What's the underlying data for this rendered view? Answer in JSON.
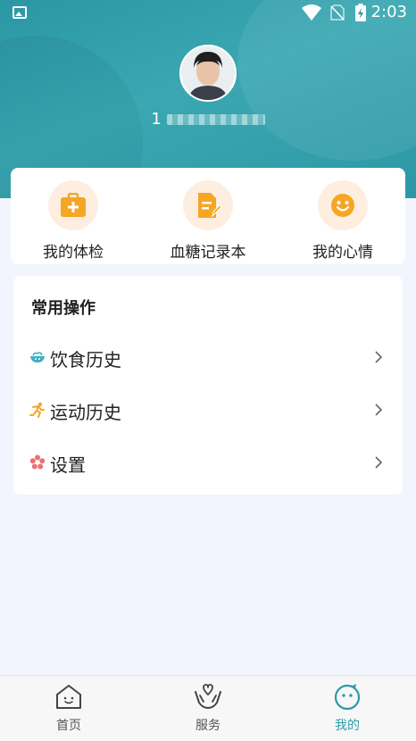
{
  "status_bar": {
    "time": "2:03"
  },
  "profile": {
    "phone_prefix": "1"
  },
  "quick_actions": [
    {
      "label": "我的体检",
      "icon": "medical-kit-icon"
    },
    {
      "label": "血糖记录本",
      "icon": "notebook-edit-icon"
    },
    {
      "label": "我的心情",
      "icon": "smile-face-icon"
    }
  ],
  "common_ops": {
    "title": "常用操作",
    "items": [
      {
        "label": "饮食历史",
        "icon": "food-bowl-icon"
      },
      {
        "label": "运动历史",
        "icon": "running-icon"
      },
      {
        "label": "设置",
        "icon": "flower-gear-icon"
      }
    ]
  },
  "tabs": [
    {
      "label": "首页",
      "icon": "home-icon",
      "active": false
    },
    {
      "label": "服务",
      "icon": "heart-hands-icon",
      "active": false
    },
    {
      "label": "我的",
      "icon": "face-icon",
      "active": true
    }
  ],
  "colors": {
    "accent": "#2f9aa6",
    "icon_orange": "#f5a623",
    "icon_bg": "#fdeee0"
  }
}
